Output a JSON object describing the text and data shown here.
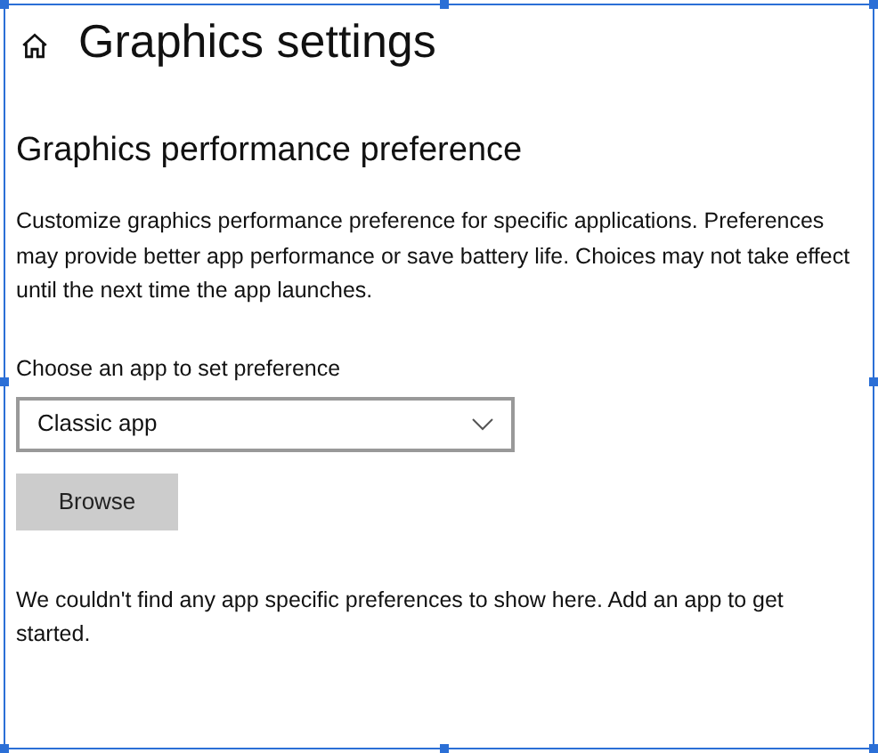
{
  "page": {
    "title": "Graphics settings"
  },
  "section": {
    "heading": "Graphics performance preference",
    "description": "Customize graphics performance preference for specific applications. Preferences may provide better app performance or save battery life. Choices may not take effect until the next time the app launches."
  },
  "app_picker": {
    "label": "Choose an app to set preference",
    "value": "Classic app"
  },
  "browse_button": "Browse",
  "empty_message": "We couldn't find any app specific preferences to show here. Add an app to get started."
}
